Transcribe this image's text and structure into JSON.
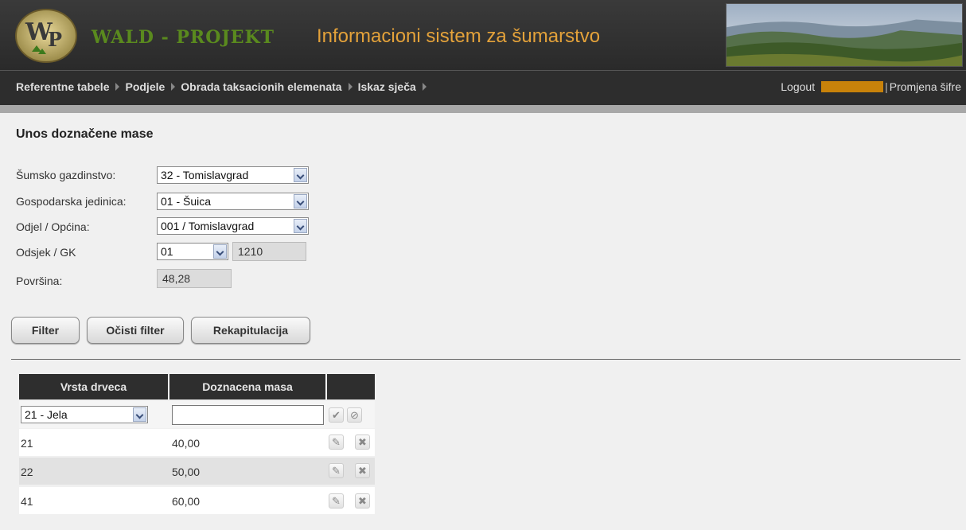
{
  "header": {
    "logo_text": "WP",
    "brand": "WALD - PROJEKT",
    "title": "Informacioni sistem za šumarstvo"
  },
  "menu": {
    "items": [
      {
        "label": "Referentne tabele"
      },
      {
        "label": "Podjele"
      },
      {
        "label": "Obrada taksacionih elemenata"
      },
      {
        "label": "Iskaz sječa"
      }
    ],
    "logout": "Logout",
    "separator": "|",
    "change_password": "Promjena šifre"
  },
  "page": {
    "title": "Unos doznačene mase"
  },
  "form": {
    "sumsko_label": "Šumsko gazdinstvo:",
    "sumsko_value": "32 - Tomislavgrad",
    "gospodarska_label": "Gospodarska jedinica:",
    "gospodarska_value": "01 - Šuica",
    "odjel_label": "Odjel / Općina:",
    "odjel_value": "001 / Tomislavgrad",
    "odsjek_label": "Odsjek / GK",
    "odsjek_value": "01",
    "gk_value": "1210",
    "povrsina_label": "Površina:",
    "povrsina_value": "48,28"
  },
  "buttons": {
    "filter": "Filter",
    "clear_filter": "Očisti filter",
    "recap": "Rekapitulacija"
  },
  "table": {
    "headers": [
      "Vrsta drveca",
      "Doznacena masa"
    ],
    "new_row": {
      "select_value": "21 - Jela",
      "mass_value": ""
    },
    "rows": [
      {
        "vrsta": "21",
        "masa": "40,00"
      },
      {
        "vrsta": "22",
        "masa": "50,00"
      },
      {
        "vrsta": "41",
        "masa": "60,00"
      }
    ]
  },
  "colors": {
    "header_bg": "#2d2d2d",
    "brand_green": "#5a8a1e",
    "title_orange": "#e4a23a",
    "user_box": "#c8820a"
  },
  "icons": {
    "confirm": "check-icon",
    "cancel": "cancel-icon",
    "edit": "pencil-icon",
    "delete": "delete-icon",
    "dropdown": "chevron-down-icon"
  }
}
